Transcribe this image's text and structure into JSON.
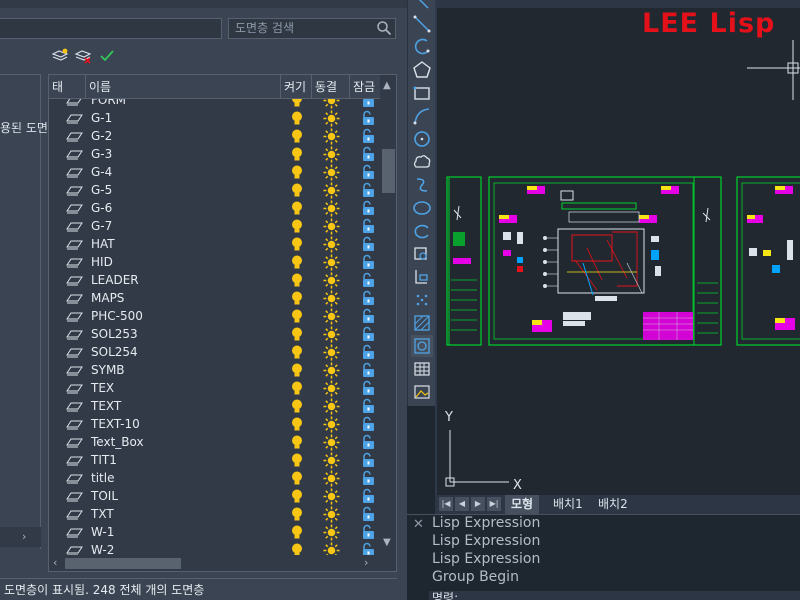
{
  "layer_panel": {
    "search_placeholder": "도면층 검색",
    "filter_tree_text": "용된 도면",
    "columns": {
      "status": "태",
      "name": "이름",
      "on": "켜기",
      "freeze": "동결",
      "lock": "잠금"
    },
    "layers": [
      {
        "name": "FORM"
      },
      {
        "name": "G-1"
      },
      {
        "name": "G-2"
      },
      {
        "name": "G-3"
      },
      {
        "name": "G-4"
      },
      {
        "name": "G-5"
      },
      {
        "name": "G-6"
      },
      {
        "name": "G-7"
      },
      {
        "name": "HAT"
      },
      {
        "name": "HID"
      },
      {
        "name": "LEADER"
      },
      {
        "name": "MAPS"
      },
      {
        "name": "PHC-500"
      },
      {
        "name": "SOL253"
      },
      {
        "name": "SOL254"
      },
      {
        "name": "SYMB"
      },
      {
        "name": "TEX"
      },
      {
        "name": "TEXT"
      },
      {
        "name": "TEXT-10"
      },
      {
        "name": "Text_Box"
      },
      {
        "name": "TIT1"
      },
      {
        "name": "title"
      },
      {
        "name": "TOIL"
      },
      {
        "name": "TXT"
      },
      {
        "name": "W-1"
      },
      {
        "name": "W-2"
      }
    ],
    "status_text": "도면층이 표시됨. 248 전체 개의 도면층",
    "icons": {
      "layer": "layer-icon",
      "on": "lightbulb-icon",
      "freeze": "sun-icon",
      "lock": "unlock-icon",
      "new_layer": "new-layer-icon",
      "delete_layer": "delete-layer-icon",
      "set_current": "checkmark-icon",
      "search": "search-icon"
    },
    "colors": {
      "bulb": "#f7c614",
      "sun": "#f7c614",
      "lock": "#4ea3e6"
    }
  },
  "canvas": {
    "watermark": "LEE Lisp",
    "ucs": {
      "x_label": "X",
      "y_label": "Y"
    }
  },
  "layout_tabs": {
    "tabs": [
      {
        "label": "모형"
      },
      {
        "label": "배치1"
      },
      {
        "label": "배치2"
      }
    ]
  },
  "command_line": {
    "history": [
      "Lisp Expression",
      "Lisp Expression",
      "Lisp Expression",
      "Group Begin"
    ],
    "prompt": "명령:"
  },
  "toolbar": {
    "tools": [
      "line-icon",
      "polyline-icon",
      "arc-icon",
      "polygon-icon",
      "rectangle-icon",
      "curve-arc-icon",
      "circle-icon",
      "revision-cloud-icon",
      "spline-icon",
      "ellipse-icon",
      "ellipse-arc-icon",
      "insert-block-icon",
      "make-block-icon",
      "point-icon",
      "hatch-icon",
      "region-icon",
      "table-icon",
      "image-icon"
    ]
  }
}
